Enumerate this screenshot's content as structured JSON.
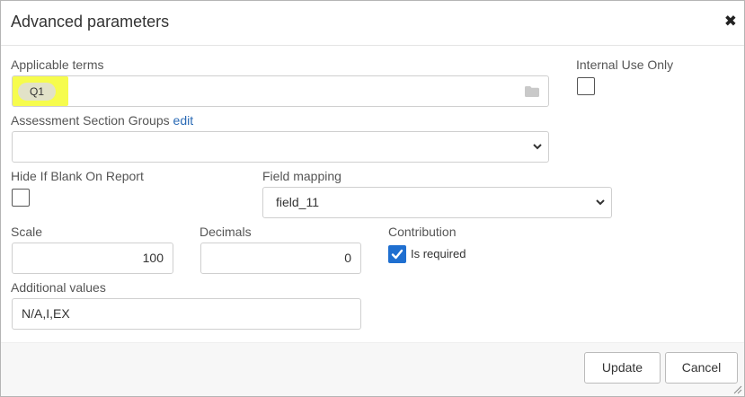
{
  "dialog": {
    "title": "Advanced parameters",
    "close_glyph": "✖"
  },
  "applicable_terms": {
    "label": "Applicable terms",
    "chip": "Q1",
    "highlight_color": "#f4fb2e"
  },
  "internal_use_only": {
    "label": "Internal Use Only",
    "checked": false
  },
  "assessment_section_groups": {
    "label": "Assessment Section Groups",
    "link": "edit",
    "value": ""
  },
  "hide_if_blank": {
    "label": "Hide If Blank On Report",
    "checked": false
  },
  "field_mapping": {
    "label": "Field mapping",
    "value": "field_11"
  },
  "scale": {
    "label": "Scale",
    "value": "100"
  },
  "decimals": {
    "label": "Decimals",
    "value": "0"
  },
  "contribution": {
    "label": "Contribution",
    "checkbox_label": "Is required",
    "checked": true,
    "accent": "#1f6fd0"
  },
  "additional_values": {
    "label": "Additional values",
    "value": "N/A,I,EX"
  },
  "footer": {
    "update_label": "Update",
    "cancel_label": "Cancel"
  }
}
